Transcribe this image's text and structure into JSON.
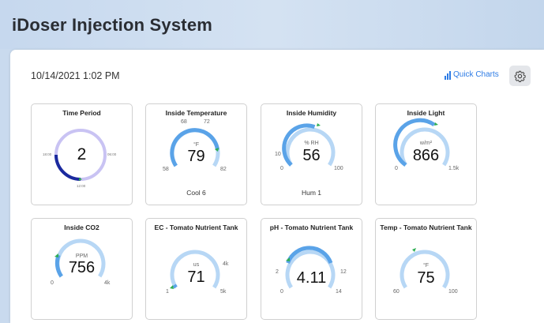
{
  "app": {
    "title": "iDoser Injection System"
  },
  "header": {
    "datetime": "10/14/2021 1:02 PM",
    "quick_charts_label": "Quick Charts",
    "settings_icon": "gear-icon",
    "chart_icon": "bar-chart-icon"
  },
  "colors": {
    "accent": "#2c7be5",
    "gauge_fill": "#5aa3e8",
    "gauge_light": "#b7d7f5",
    "marker": "#2eae53",
    "clock_fill": "#1b2a9e",
    "clock_light": "#c9c3f3"
  },
  "cards": [
    {
      "title": "Time Period",
      "value": "2",
      "ticks": [
        "18:00",
        "00:00",
        "06:00",
        "12:00"
      ]
    },
    {
      "title": "Inside Temperature",
      "unit": "°F",
      "value": "79",
      "min": "58",
      "max": "82",
      "sp_low": "68",
      "sp_high": "72",
      "status": "Cool 6"
    },
    {
      "title": "Inside Humidity",
      "unit": "% RH",
      "value": "56",
      "min": "0",
      "max": "100",
      "sp_low": "10",
      "status": "Hum 1"
    },
    {
      "title": "Inside Light",
      "unit": "w/m²",
      "value": "866",
      "min": "0",
      "max": "1.5k"
    },
    {
      "title": "Inside CO2",
      "unit": "PPM",
      "value": "756",
      "min": "0",
      "max": "4k"
    },
    {
      "title": "EC - Tomato Nutrient Tank",
      "unit": "us",
      "value": "71",
      "min": "1",
      "max": "5k",
      "sp_high": "4k"
    },
    {
      "title": "pH - Tomato Nutrient Tank",
      "value": "4.11",
      "min": "0",
      "max": "14",
      "sp_low": "2",
      "sp_high": "12"
    },
    {
      "title": "Temp - Tomato Nutrient Tank",
      "unit": "°F",
      "value": "75",
      "min": "60",
      "max": "100"
    }
  ]
}
